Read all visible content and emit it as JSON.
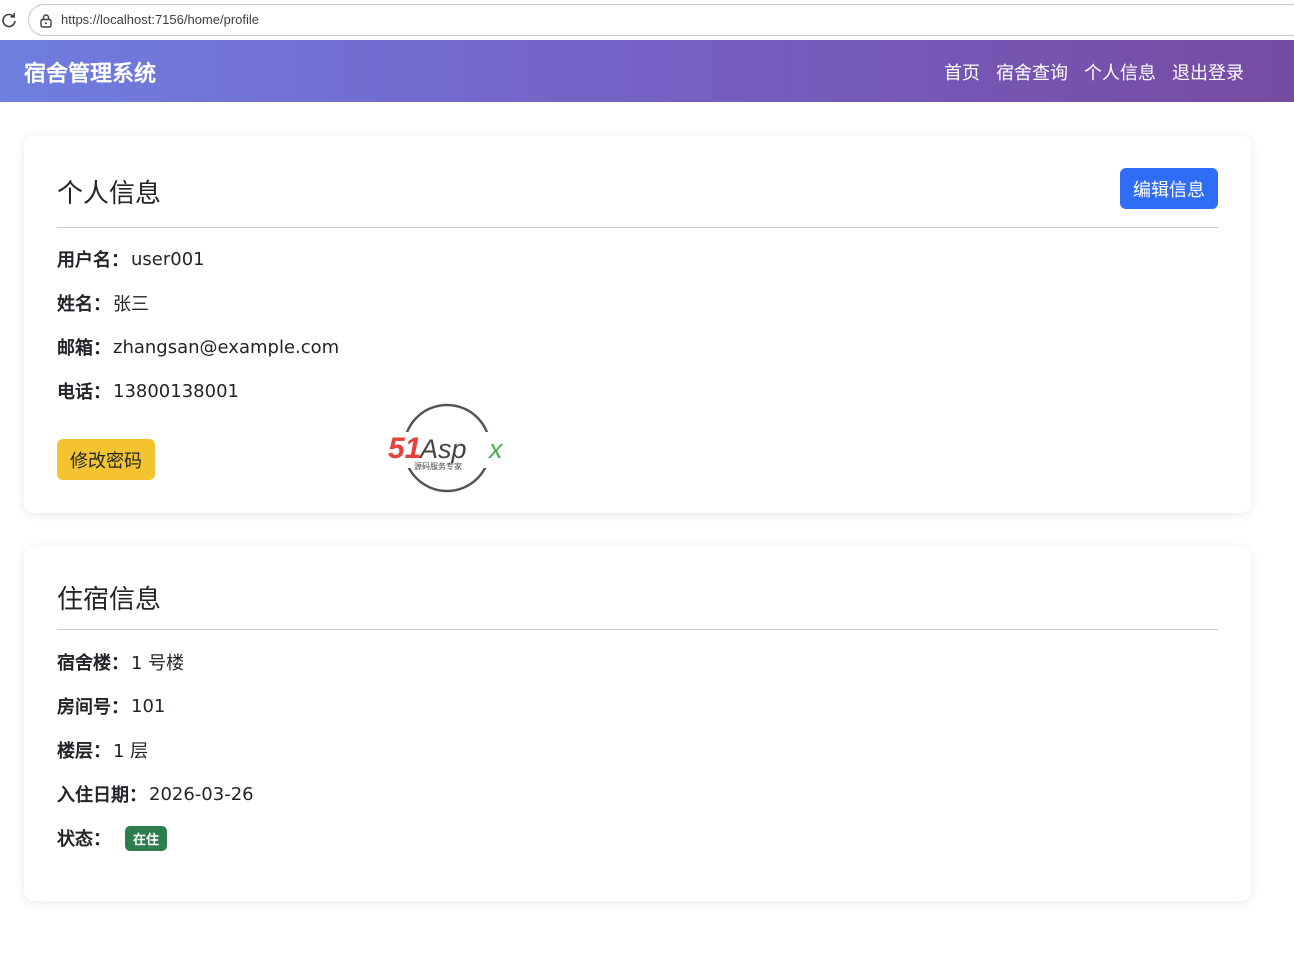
{
  "browser": {
    "url": "https://localhost:7156/home/profile",
    "reload_icon": "reload-icon",
    "lock_icon": "lock-icon"
  },
  "navbar": {
    "brand": "宿舍管理系统",
    "links": [
      "首页",
      "宿舍查询",
      "个人信息",
      "退出登录"
    ],
    "gradient_start": "#6e7fe0",
    "gradient_end": "#764ba2"
  },
  "personal": {
    "title": "个人信息",
    "edit_button": "编辑信息",
    "fields": [
      {
        "label": "用户名：",
        "value": "user001"
      },
      {
        "label": "姓名：",
        "value": "张三"
      },
      {
        "label": "邮箱：",
        "value": "zhangsan@example.com"
      },
      {
        "label": "电话：",
        "value": "13800138001"
      }
    ],
    "change_password_button": "修改密码",
    "edit_button_color": "#2f6df6",
    "password_button_color": "#f4c430"
  },
  "lodging": {
    "title": "住宿信息",
    "fields": [
      {
        "label": "宿舍楼：",
        "value": "1 号楼"
      },
      {
        "label": "房间号：",
        "value": "101"
      },
      {
        "label": "楼层：",
        "value": "1 层"
      },
      {
        "label": "入住日期：",
        "value": "2026-03-26"
      }
    ],
    "status_label": "状态：",
    "status_badge": "在住",
    "status_color": "#2e7d4f"
  },
  "watermark": {
    "brand_red": "51",
    "brand_dark": "Asp",
    "brand_green": "x",
    "tagline": "源码服务专家"
  }
}
